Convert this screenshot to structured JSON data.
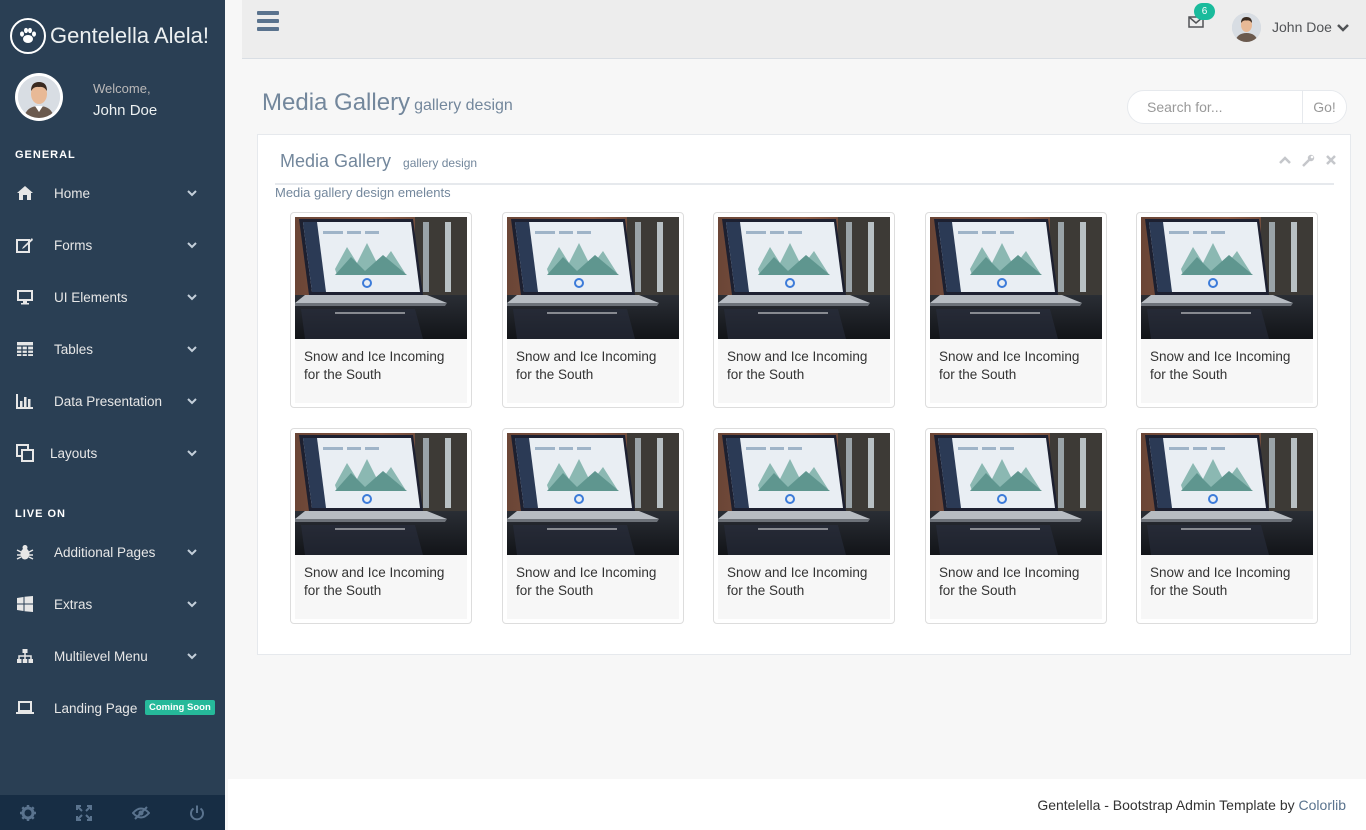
{
  "app": {
    "title": "Gentelella Alela!"
  },
  "profile": {
    "welcome": "Welcome,",
    "name": "John Doe"
  },
  "sidebar": {
    "sections": [
      {
        "title": "GENERAL"
      },
      {
        "title": "LIVE ON"
      }
    ],
    "items": [
      {
        "label": "Home",
        "icon": "home-icon"
      },
      {
        "label": "Forms",
        "icon": "edit-icon"
      },
      {
        "label": "UI Elements",
        "icon": "desktop-icon"
      },
      {
        "label": "Tables",
        "icon": "table-icon"
      },
      {
        "label": "Data Presentation",
        "icon": "bar-chart-icon"
      },
      {
        "label": "Layouts",
        "icon": "clone-icon"
      },
      {
        "label": "Additional Pages",
        "icon": "bug-icon"
      },
      {
        "label": "Extras",
        "icon": "windows-icon"
      },
      {
        "label": "Multilevel Menu",
        "icon": "sitemap-icon"
      },
      {
        "label": "Landing Page",
        "icon": "laptop-icon",
        "badge": "Coming Soon"
      }
    ],
    "footer": [
      "settings-icon",
      "fullscreen-icon",
      "lock-eye-icon",
      "power-icon"
    ]
  },
  "topnav": {
    "mail_count": "6",
    "user_name": "John Doe"
  },
  "page": {
    "title": "Media Gallery",
    "subtitle": "gallery design",
    "search": {
      "placeholder": "Search for...",
      "button": "Go!"
    }
  },
  "panel": {
    "title": "Media Gallery",
    "subtitle": "gallery design",
    "description": "Media gallery design emelents",
    "items": [
      {
        "caption": "Snow and Ice Incoming for the South"
      },
      {
        "caption": "Snow and Ice Incoming for the South"
      },
      {
        "caption": "Snow and Ice Incoming for the South"
      },
      {
        "caption": "Snow and Ice Incoming for the South"
      },
      {
        "caption": "Snow and Ice Incoming for the South"
      },
      {
        "caption": "Snow and Ice Incoming for the South"
      },
      {
        "caption": "Snow and Ice Incoming for the South"
      },
      {
        "caption": "Snow and Ice Incoming for the South"
      },
      {
        "caption": "Snow and Ice Incoming for the South"
      },
      {
        "caption": "Snow and Ice Incoming for the South"
      }
    ]
  },
  "footer": {
    "text": "Gentelella - Bootstrap Admin Template by",
    "link": "Colorlib"
  },
  "colors": {
    "sidebar": "#2A3F54",
    "accent": "#1ABB9C",
    "badge": "#26B99A"
  }
}
